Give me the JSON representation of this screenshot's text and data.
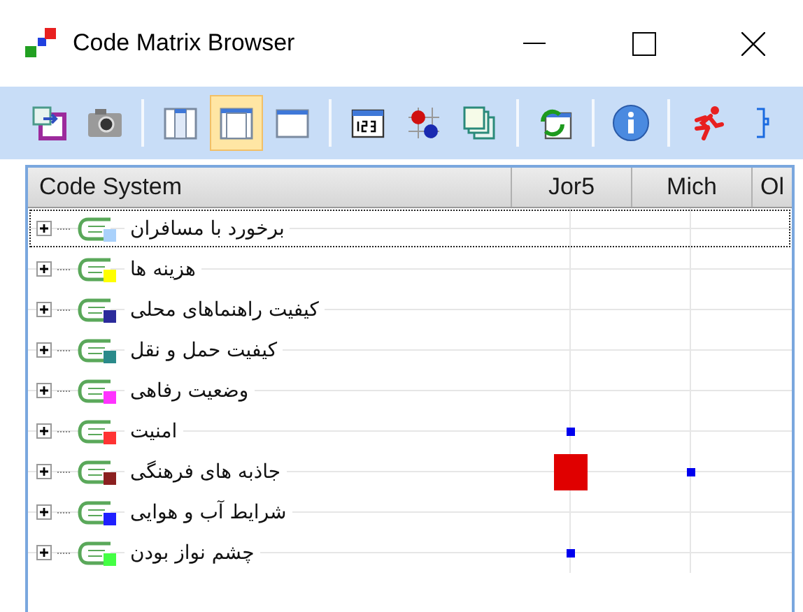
{
  "window": {
    "title": "Code Matrix Browser"
  },
  "toolbar": {
    "groups": [
      [
        {
          "selected": false
        },
        {
          "selected": false
        }
      ],
      [
        {
          "selected": false
        },
        {
          "selected": true
        },
        {
          "selected": false
        }
      ],
      [
        {
          "selected": false
        },
        {
          "selected": false
        },
        {
          "selected": false
        }
      ],
      [
        {
          "selected": false
        }
      ],
      [
        {
          "selected": false
        }
      ],
      [
        {
          "selected": false
        },
        {
          "selected": false
        }
      ]
    ]
  },
  "matrix": {
    "header": {
      "column_1": "Code System",
      "column_2": "Jor5",
      "column_3": "Mich",
      "column_4": "Ol"
    },
    "rows": [
      {
        "label": "برخورد با مسافران",
        "color": "#a9d1fb",
        "focused": true,
        "cells": [
          {
            "kind": "none"
          },
          {
            "kind": "none"
          },
          {
            "kind": "none"
          }
        ]
      },
      {
        "label": "هزینه ها",
        "color": "#ffff00",
        "focused": false,
        "cells": [
          {
            "kind": "none"
          },
          {
            "kind": "none"
          },
          {
            "kind": "none"
          }
        ]
      },
      {
        "label": "کیفیت راهنماهای محلی",
        "color": "#2b2b9b",
        "focused": false,
        "cells": [
          {
            "kind": "none"
          },
          {
            "kind": "none"
          },
          {
            "kind": "none"
          }
        ]
      },
      {
        "label": "کیفیت حمل و نقل",
        "color": "#2a8a8a",
        "focused": false,
        "cells": [
          {
            "kind": "none"
          },
          {
            "kind": "none"
          },
          {
            "kind": "none"
          }
        ]
      },
      {
        "label": "وضعیت رفاهی",
        "color": "#ff33ff",
        "focused": false,
        "cells": [
          {
            "kind": "none"
          },
          {
            "kind": "none"
          },
          {
            "kind": "none"
          }
        ]
      },
      {
        "label": "امنیت",
        "color": "#ff3333",
        "focused": false,
        "cells": [
          {
            "kind": "small"
          },
          {
            "kind": "none"
          },
          {
            "kind": "none"
          }
        ]
      },
      {
        "label": "جاذبه های فرهنگی",
        "color": "#8b2020",
        "focused": false,
        "cells": [
          {
            "kind": "large"
          },
          {
            "kind": "small"
          },
          {
            "kind": "none"
          }
        ]
      },
      {
        "label": "شرایط آب و هوایی",
        "color": "#2020ff",
        "focused": false,
        "cells": [
          {
            "kind": "none"
          },
          {
            "kind": "none"
          },
          {
            "kind": "none"
          }
        ]
      },
      {
        "label": "چشم نواز بودن",
        "color": "#44ff44",
        "focused": false,
        "cells": [
          {
            "kind": "small"
          },
          {
            "kind": "none"
          },
          {
            "kind": "none"
          }
        ]
      }
    ]
  }
}
